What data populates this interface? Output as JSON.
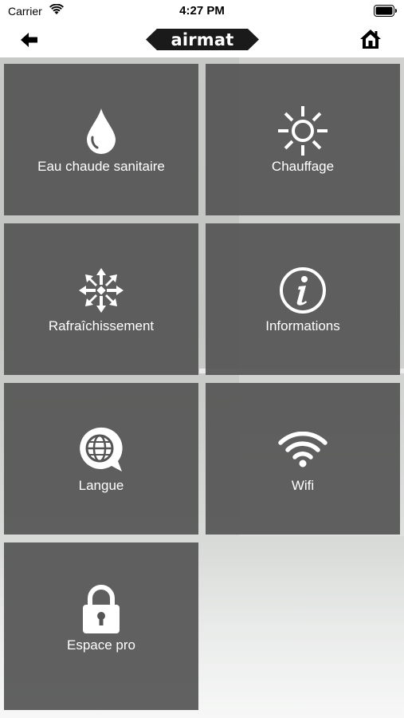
{
  "status_bar": {
    "carrier": "Carrier",
    "time": "4:27 PM"
  },
  "nav": {
    "logo_text": "airmat",
    "back_icon": "back-arrow-icon",
    "home_icon": "home-icon"
  },
  "menu": {
    "tiles": [
      {
        "label": "Eau chaude sanitaire",
        "icon": "water-drop-icon"
      },
      {
        "label": "Chauffage",
        "icon": "sun-icon"
      },
      {
        "label": "Rafraîchissement",
        "icon": "snowflake-icon"
      },
      {
        "label": "Informations",
        "icon": "info-icon"
      },
      {
        "label": "Langue",
        "icon": "globe-chat-icon"
      },
      {
        "label": "Wifi",
        "icon": "wifi-icon"
      },
      {
        "label": "Espace pro",
        "icon": "lock-icon"
      }
    ]
  },
  "colors": {
    "tile_background": "#555555",
    "tile_text": "#ffffff",
    "logo_background": "#1a1a1a"
  }
}
